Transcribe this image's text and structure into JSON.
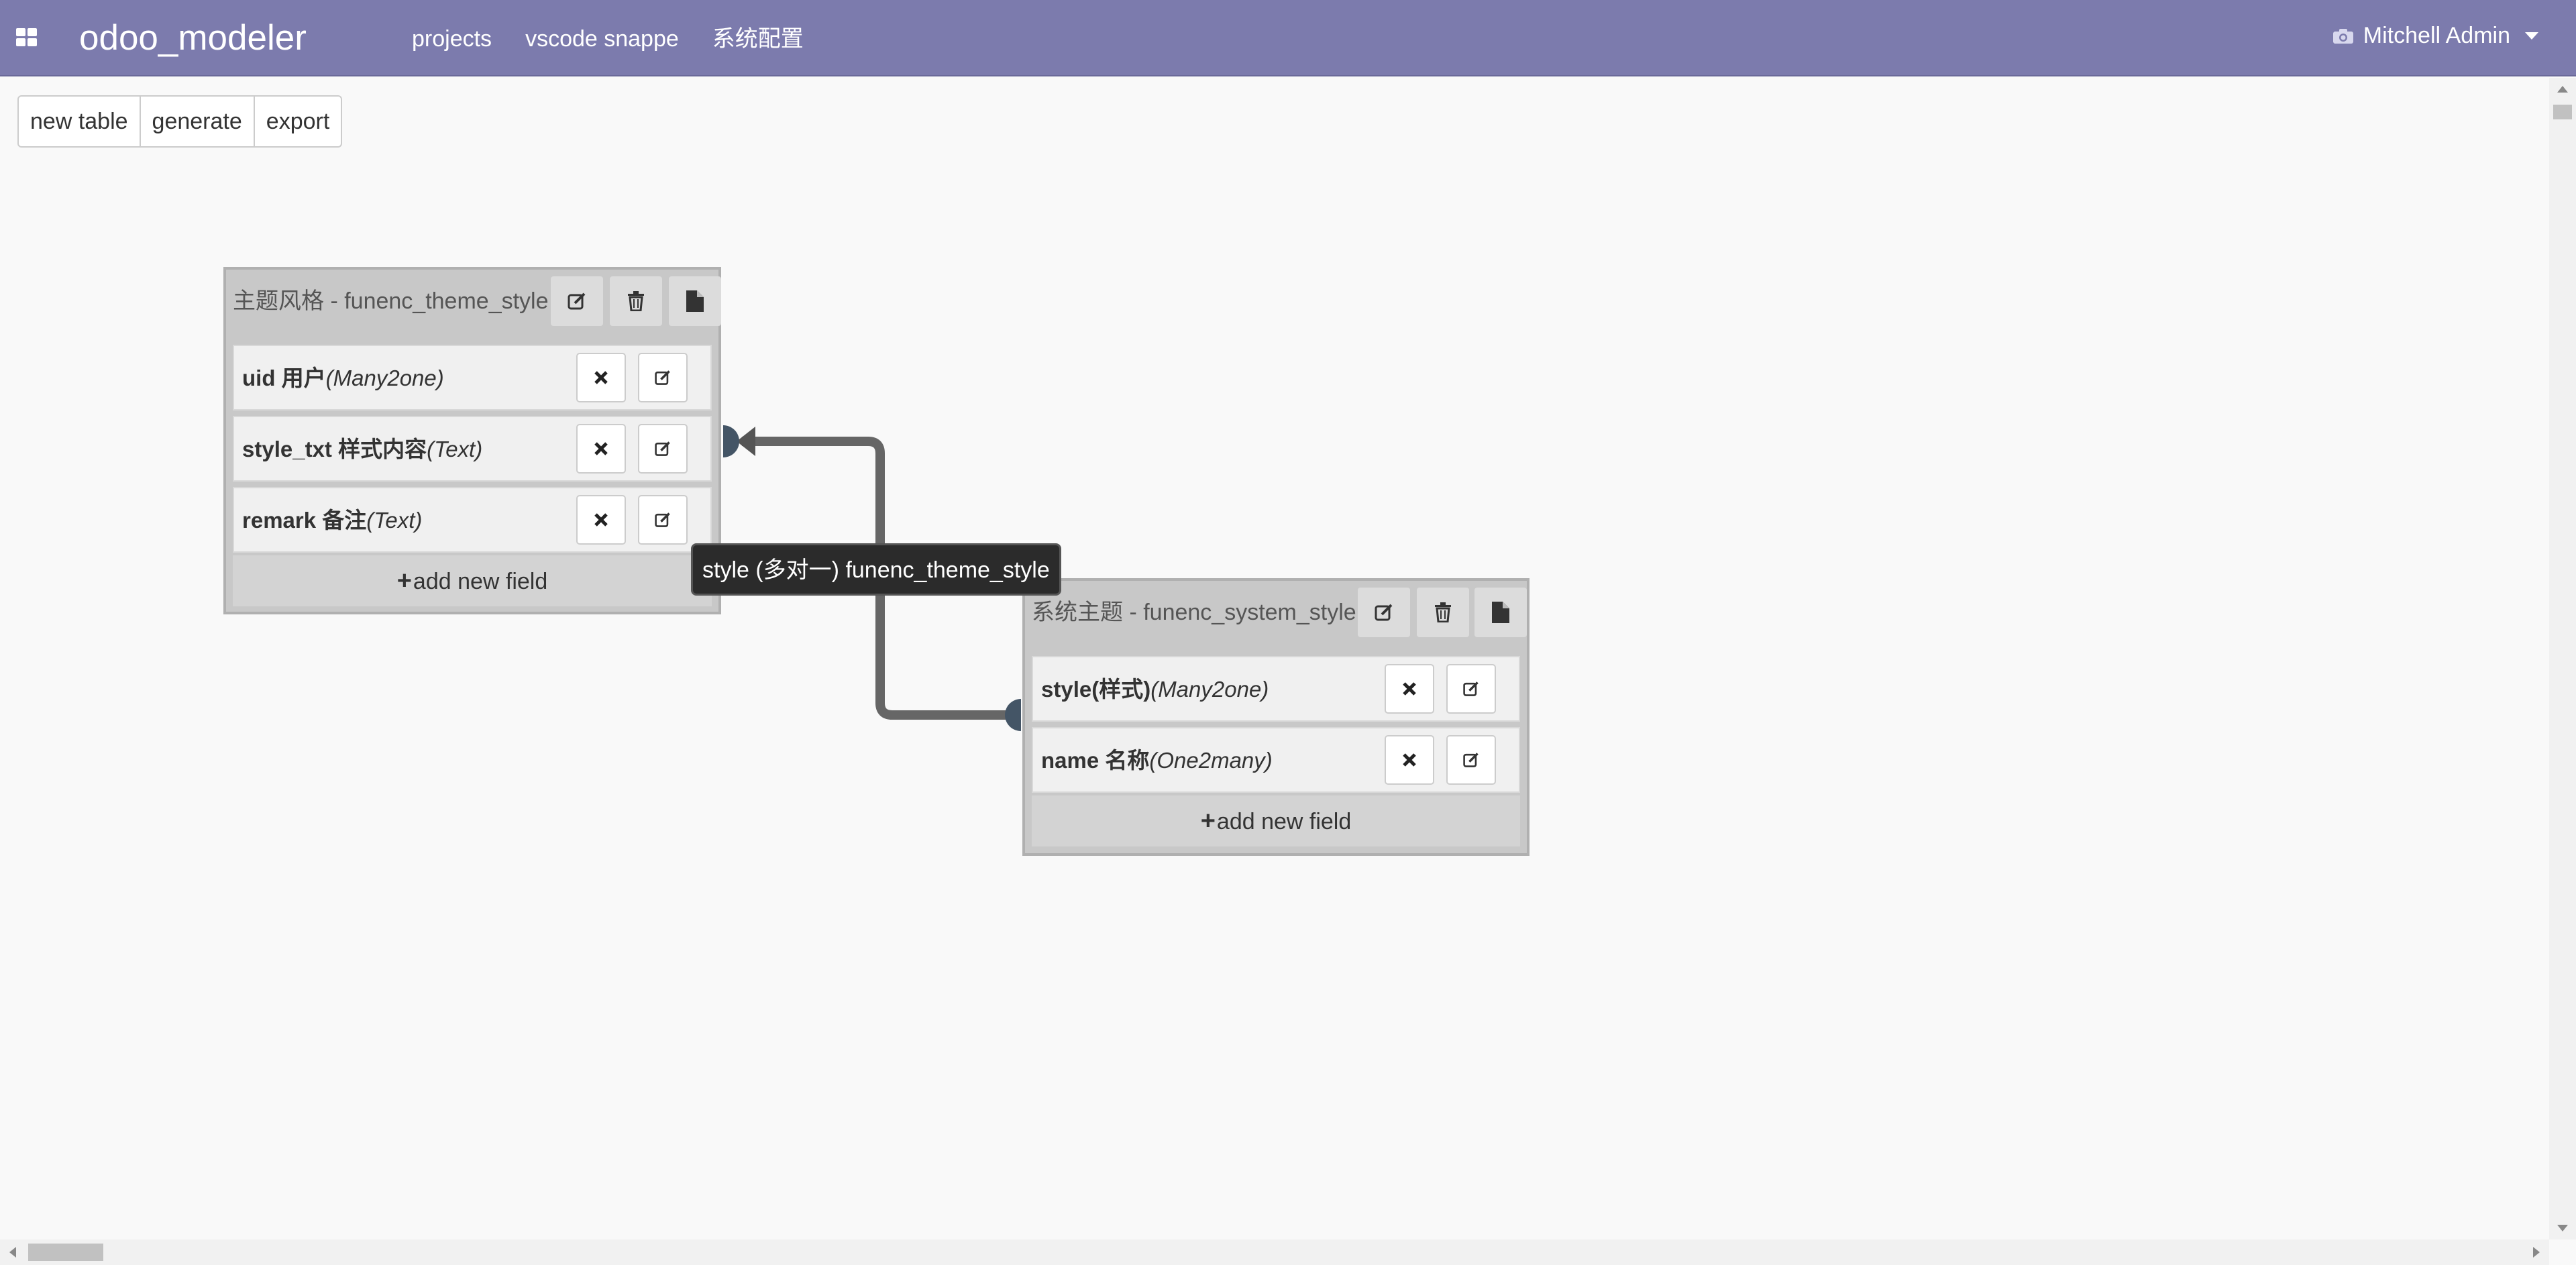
{
  "navbar": {
    "brand": "odoo_modeler",
    "menu": [
      "projects",
      "vscode snappe",
      "系统配置"
    ],
    "user": "Mitchell Admin",
    "bg_color": "#7c7bad"
  },
  "toolbar": {
    "new_table": "new table",
    "generate": "generate",
    "export": "export"
  },
  "tables": [
    {
      "title": "主题风格 - funenc_theme_style",
      "fields": [
        {
          "name": "uid 用户",
          "type": "(Many2one)"
        },
        {
          "name": "style_txt 样式内容",
          "type": "(Text)"
        },
        {
          "name": "remark 备注",
          "type": "(Text)"
        }
      ],
      "add_field": "add new field"
    },
    {
      "title": "系统主题 - funenc_system_style",
      "fields": [
        {
          "name": "style(样式)",
          "type": "(Many2one)"
        },
        {
          "name": "name 名称",
          "type": "(One2many)"
        }
      ],
      "add_field": "add new field"
    }
  ],
  "relation_tooltip": "style (多对一) funenc_theme_style",
  "icons": {
    "edit": "edit-icon",
    "delete": "trash-icon",
    "file": "file-icon",
    "remove": "close-icon",
    "apps": "apps-grid-icon",
    "user": "camera-icon"
  }
}
